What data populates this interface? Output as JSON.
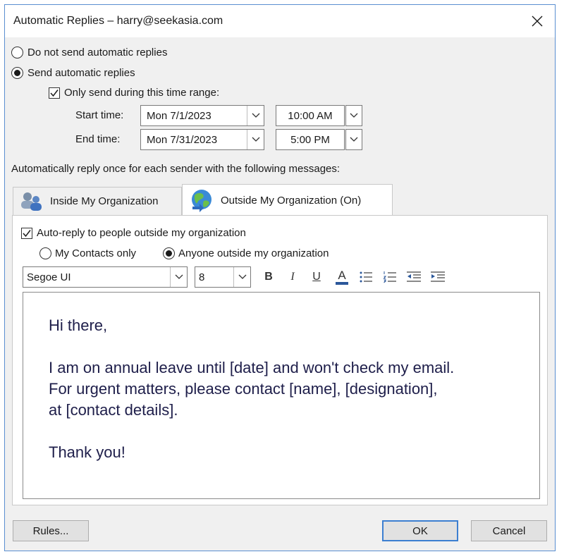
{
  "window": {
    "title": "Automatic Replies – harry@seekasia.com"
  },
  "mode": {
    "do_not_send_label": "Do not send automatic replies",
    "send_label": "Send automatic replies",
    "selected": "send"
  },
  "time_range": {
    "only_send_label": "Only send during this time range:",
    "checked": true,
    "start_label": "Start time:",
    "start_date": "Mon 7/1/2023",
    "start_time": "10:00 AM",
    "end_label": "End time:",
    "end_date": "Mon 7/31/2023",
    "end_time": "5:00 PM"
  },
  "instruction": "Automatically reply once for each sender with the following messages:",
  "tabs": [
    {
      "label": "Inside My Organization",
      "active": false
    },
    {
      "label": "Outside My Organization (On)",
      "active": true
    }
  ],
  "outside": {
    "auto_reply_label": "Auto-reply to people outside my organization",
    "auto_reply_checked": true,
    "contacts_only_label": "My Contacts only",
    "anyone_label": "Anyone outside my organization",
    "audience_selected": "anyone"
  },
  "toolbar": {
    "font": "Segoe UI",
    "size": "8",
    "bold": "B",
    "italic": "I",
    "underline": "U",
    "font_color": "A"
  },
  "message": {
    "greeting": "Hi there,",
    "line1": "I am on annual leave until [date] and won't check my email.",
    "line2": "For urgent matters, please contact [name], [designation],",
    "line3": "at [contact details].",
    "closing": "Thank you!"
  },
  "buttons": {
    "rules": "Rules...",
    "ok": "OK",
    "cancel": "Cancel"
  },
  "colors": {
    "accent": "#3c7fd1",
    "message_text": "#1e1e4a",
    "font_color_bar": "#2b579a"
  }
}
